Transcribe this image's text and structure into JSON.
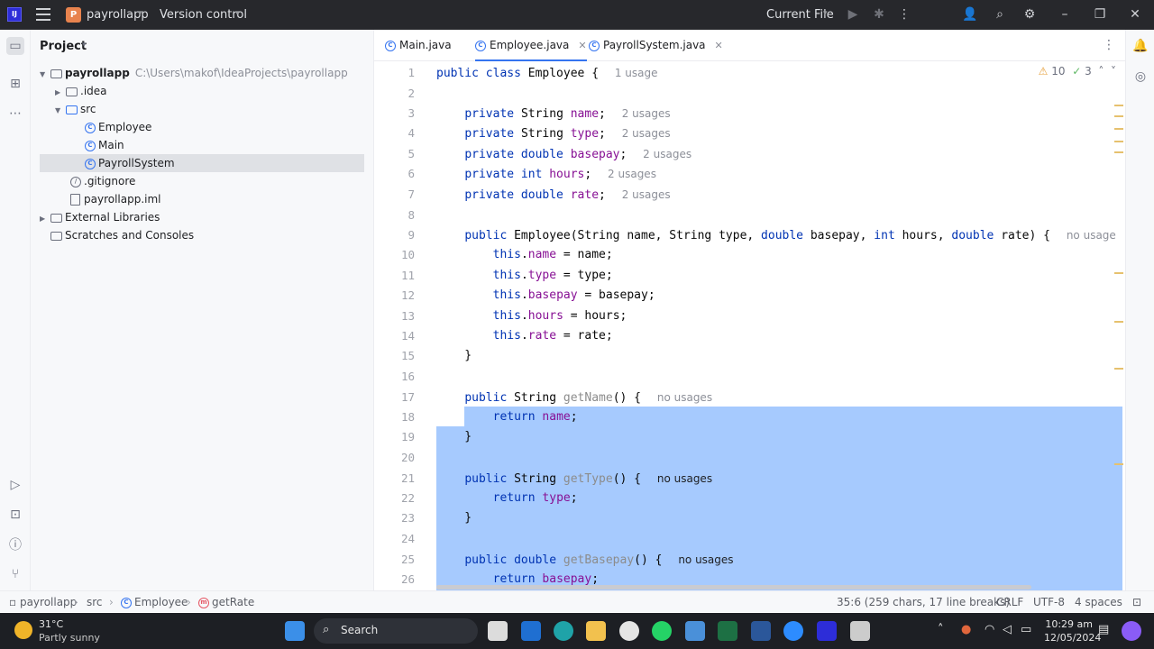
{
  "titlebar": {
    "app_logo": "IJ",
    "project_badge": "P",
    "project_name": "payrollapp",
    "version_control": "Version control",
    "run_config": "Current File"
  },
  "project_panel": {
    "title": "Project",
    "root": {
      "label": "payrollapp",
      "path": "C:\\Users\\makof\\IdeaProjects\\payrollapp"
    },
    "items": [
      {
        "label": ".idea"
      },
      {
        "label": "src"
      },
      {
        "label": "Employee"
      },
      {
        "label": "Main"
      },
      {
        "label": "PayrollSystem"
      },
      {
        "label": ".gitignore"
      },
      {
        "label": "payrollapp.iml"
      },
      {
        "label": "External Libraries"
      },
      {
        "label": "Scratches and Consoles"
      }
    ]
  },
  "tabs": [
    {
      "label": "Main.java"
    },
    {
      "label": "Employee.java"
    },
    {
      "label": "PayrollSystem.java"
    }
  ],
  "inspections": {
    "warnings": "10",
    "ok": "3"
  },
  "editor": {
    "line_numbers": [
      "1",
      "2",
      "3",
      "4",
      "5",
      "6",
      "7",
      "8",
      "9",
      "10",
      "11",
      "12",
      "13",
      "14",
      "15",
      "16",
      "17",
      "18",
      "19",
      "20",
      "21",
      "22",
      "23",
      "24",
      "25",
      "26"
    ],
    "hints": {
      "l1": "1 usage",
      "l3": "2 usages",
      "l4": "2 usages",
      "l5": "2 usages",
      "l6": "2 usages",
      "l7": "2 usages",
      "l9": "no usage",
      "l17": "no usages",
      "l21": "no usages",
      "l25": "no usages"
    }
  },
  "statusbar": {
    "crumbs": [
      "payrollapp",
      "src",
      "Employee",
      "getRate"
    ],
    "position": "35:6 (259 chars, 17 line breaks)",
    "line_sep": "CRLF",
    "encoding": "UTF-8",
    "indent": "4 spaces"
  },
  "taskbar": {
    "temp": "31°C",
    "weather": "Partly sunny",
    "search": "Search",
    "time": "10:29 am",
    "date": "12/05/2024"
  }
}
